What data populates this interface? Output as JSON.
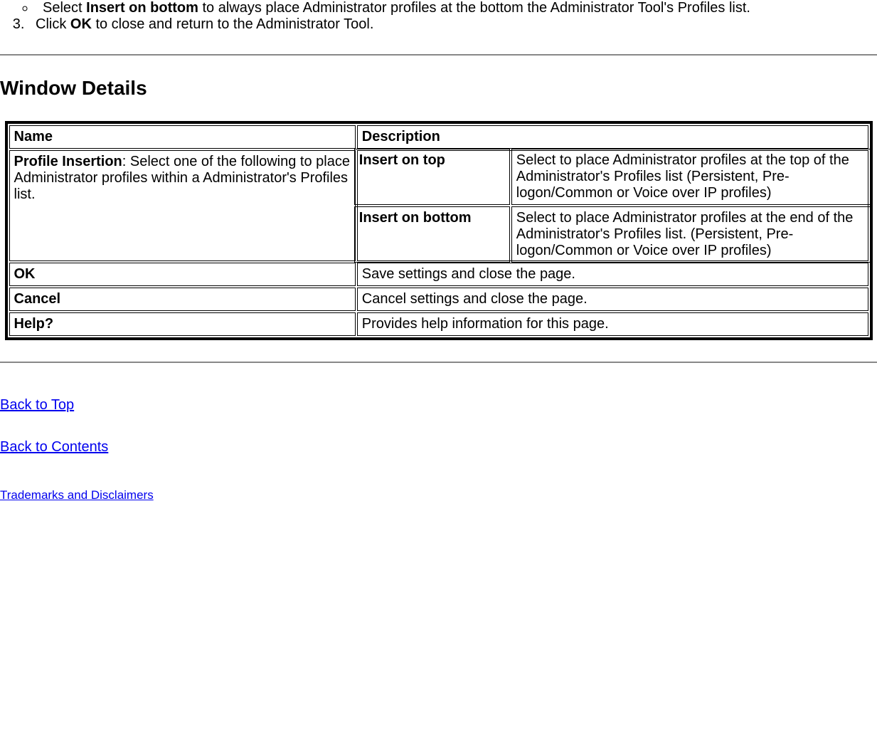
{
  "instructions": {
    "sub_bullet_prefix": "Select ",
    "sub_bullet_bold": "Insert on bottom",
    "sub_bullet_suffix": " to always place Administrator profiles at the bottom the Administrator Tool's Profiles list.",
    "step3_prefix": "Click ",
    "step3_bold": "OK",
    "step3_suffix": " to close and return to the Administrator Tool."
  },
  "section_heading": "Window Details",
  "table": {
    "head_name": "Name",
    "head_desc": "Description",
    "row1_name_bold": "Profile Insertion",
    "row1_name_rest": ": Select one of the following to place Administrator profiles within a Administrator's Profiles list.",
    "row1_sub1_name": "Insert on top",
    "row1_sub1_desc": "Select to place Administrator profiles at the top of the Administrator's Profiles list (Persistent, Pre-logon/Common or Voice over IP profiles)",
    "row1_sub2_name": "Insert on bottom",
    "row1_sub2_desc": "Select to place Administrator profiles at the end of the Administrator's Profiles list. (Persistent, Pre-logon/Common or Voice over IP profiles)",
    "row2_name": "OK",
    "row2_desc": "Save settings and close the page.",
    "row3_name": "Cancel",
    "row3_desc": "Cancel settings and close the page.",
    "row4_name": "Help?",
    "row4_desc": "Provides help information for this page."
  },
  "links": {
    "back_to_top": "Back to Top",
    "back_to_contents": "Back to Contents",
    "trademarks": "Trademarks and Disclaimers"
  }
}
